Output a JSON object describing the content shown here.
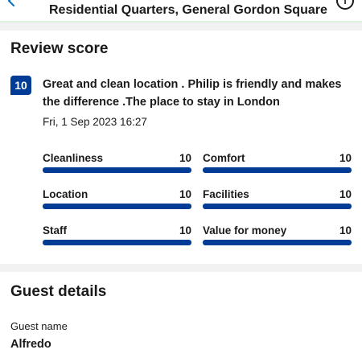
{
  "header": {
    "title": "Residential Quarters, General Gordon Square",
    "back_icon": "arrow-left-icon",
    "info_icon": "info-circle-icon"
  },
  "review": {
    "section_title": "Review score",
    "score": "10",
    "text": "Great and clean location . Philip is friendly and makes the difference .The place to stay in London",
    "date": "Fri, 1 Sep 2023 16:27",
    "ratings": [
      {
        "label": "Cleanliness",
        "value": "10",
        "fraction": 1.0
      },
      {
        "label": "Comfort",
        "value": "10",
        "fraction": 1.0
      },
      {
        "label": "Location",
        "value": "10",
        "fraction": 1.0
      },
      {
        "label": "Facilities",
        "value": "10",
        "fraction": 1.0
      },
      {
        "label": "Staff",
        "value": "10",
        "fraction": 1.0
      },
      {
        "label": "Value for money",
        "value": "10",
        "fraction": 1.0
      }
    ]
  },
  "guest": {
    "section_title": "Guest details",
    "name_label": "Guest name",
    "name": "Alfredo"
  },
  "colors": {
    "accent": "#003b95",
    "track": "#e6e6e6",
    "band": "#f2f2f2"
  }
}
